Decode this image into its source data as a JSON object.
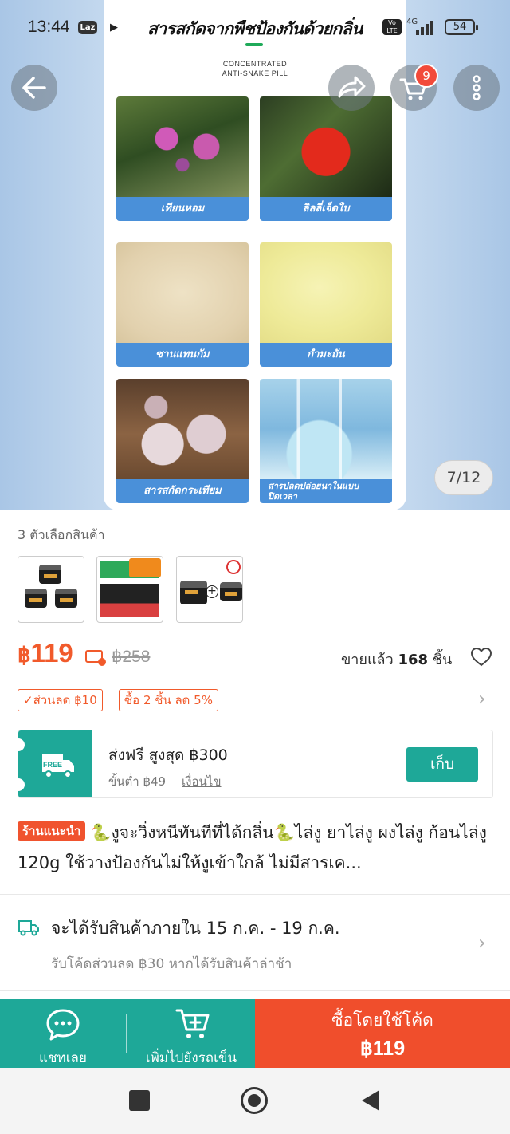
{
  "status_bar": {
    "time": "13:44",
    "app_badge": "Laz",
    "network": "4G",
    "volte": "Vo LTE",
    "battery": "54"
  },
  "gallery": {
    "poster_title": "สารสกัดจากพืชป้องกันด้วยกลิ่น",
    "poster_subtitle_line1": "CONCENTRATED",
    "poster_subtitle_line2": "ANTI-SNAKE PILL",
    "tiles": [
      {
        "caption": "เทียนหอม",
        "icon": "impatiens-flower-photo"
      },
      {
        "caption": "ลิลลี่เจ็ดใบ",
        "icon": "red-berry-photo"
      },
      {
        "caption": "ซานแทนกัม",
        "icon": "beige-powder-photo"
      },
      {
        "caption": "กำมะถัน",
        "icon": "sulfur-powder-photo"
      },
      {
        "caption": "สารสกัดกระเทียม",
        "icon": "garlic-photo"
      },
      {
        "caption_line1": "สารปลดปล่อยนาในแบบ",
        "caption_line2": "ปิดเวลา",
        "icon": "lab-flask-photo"
      }
    ],
    "counter": "7/12",
    "cart_count": "9"
  },
  "product": {
    "options_label": "3 ตัวเลือกสินค้า",
    "price_currency": "฿",
    "price_value": "119",
    "original_price": "฿258",
    "sold_prefix": "ขายแล้ว",
    "sold_count": "168",
    "sold_suffix": "ชิ้น",
    "promo_discount": "✓ส่วนลด ฿10",
    "promo_bundle": "ซื้อ 2 ชิ้น ลด 5%",
    "shipping_title": "ส่งฟรี สูงสุด ฿300",
    "shipping_min": "ขั้นต่ำ ฿49",
    "shipping_condition": "เงื่อนไข",
    "shipping_badge": "FREE",
    "collect_label": "เก็บ",
    "rec_badge": "ร้านแนะนำ",
    "title": "🐍งูจะวิ่งหนีทันทีที่ได้กลิ่น🐍ไล่งู ยาไล่งู ผงไล่งู ก้อนไล่งู 120g ใช้วางป้องกันไม่ให้งูเข้าใกล้  ไม่มีสารเค...",
    "delivery_main": "จะได้รับสินค้าภายใน 15 ก.ค. - 19 ก.ค.",
    "delivery_sub": "รับโค้ดส่วนลด ฿30 หากได้รับสินค้าล่าช้า"
  },
  "actions": {
    "chat_label": "แชทเลย",
    "add_cart_label": "เพิ่มไปยังรถเข็น",
    "buy_line1": "ซื้อโดยใช้โค้ด",
    "buy_line2": "฿119"
  },
  "colors": {
    "accent_orange": "#f15a2b",
    "teal": "#1ea898",
    "buy_red": "#f04e2c",
    "caption_blue": "#4a90d9"
  }
}
